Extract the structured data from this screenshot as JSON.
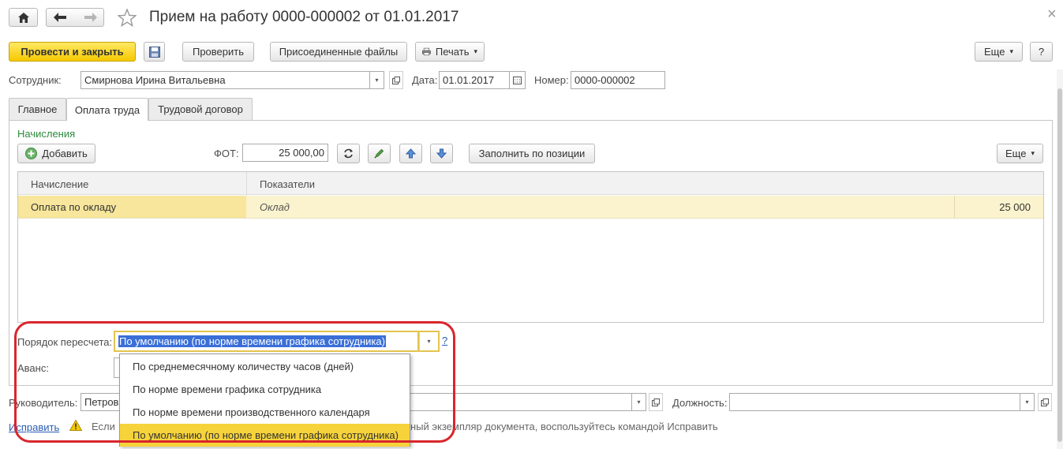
{
  "window": {
    "title": "Прием на работу 0000-000002 от 01.01.2017",
    "nav_home_icon": "home-icon",
    "nav_back_icon": "arrow-left-icon",
    "nav_forward_icon": "arrow-right-icon",
    "favorite_icon": "star-icon",
    "close_glyph": "×"
  },
  "toolbar": {
    "post_close": "Провести и закрыть",
    "check": "Проверить",
    "attached_files": "Присоединенные файлы",
    "print": "Печать",
    "more": "Еще",
    "help": "?",
    "dropdown_glyph": "▾"
  },
  "header_fields": {
    "employee_label": "Сотрудник:",
    "employee_value": "Смирнова Ирина Витальевна",
    "date_label": "Дата:",
    "date_value": "01.01.2017",
    "number_label": "Номер:",
    "number_value": "0000-000002"
  },
  "tabs": [
    {
      "label": "Главное"
    },
    {
      "label": "Оплата труда"
    },
    {
      "label": "Трудовой договор"
    }
  ],
  "accruals": {
    "section_title": "Начисления",
    "add_button": "Добавить",
    "fot_label": "ФОТ:",
    "fot_value": "25 000,00",
    "fill_by_position": "Заполнить по позиции",
    "more": "Еще",
    "columns": [
      "Начисление",
      "Показатели"
    ],
    "rows": [
      {
        "accrual": "Оплата по окладу",
        "indicator": "Оклад",
        "value": "25 000"
      }
    ]
  },
  "recalc": {
    "label": "Порядок пересчета:",
    "value": "По умолчанию (по норме времени графика сотрудника)",
    "help": "?",
    "options": [
      "По среднемесячному количеству часов (дней)",
      "По норме времени графика сотрудника",
      "По норме времени производственного календаря",
      "По умолчанию (по норме времени графика сотрудника)"
    ],
    "selected_index": 3
  },
  "advance": {
    "label": "Аванс:"
  },
  "footer": {
    "manager_label": "Руководитель:",
    "manager_value": "Петров",
    "position_label": "Должность:",
    "position_value": "",
    "fix_link": "Исправить",
    "warning_prefix": "Если",
    "warning_suffix": "ный экземпляр документа, воспользуйтесь командой Исправить"
  },
  "colors": {
    "primary_button": "#f5c900",
    "selected_row": "#fbf3cd",
    "menu_selected": "#f7d33b",
    "section_title": "#2a8a3c",
    "highlight_ring": "#d9262c",
    "selection_text_bg": "#3a6fd8"
  }
}
